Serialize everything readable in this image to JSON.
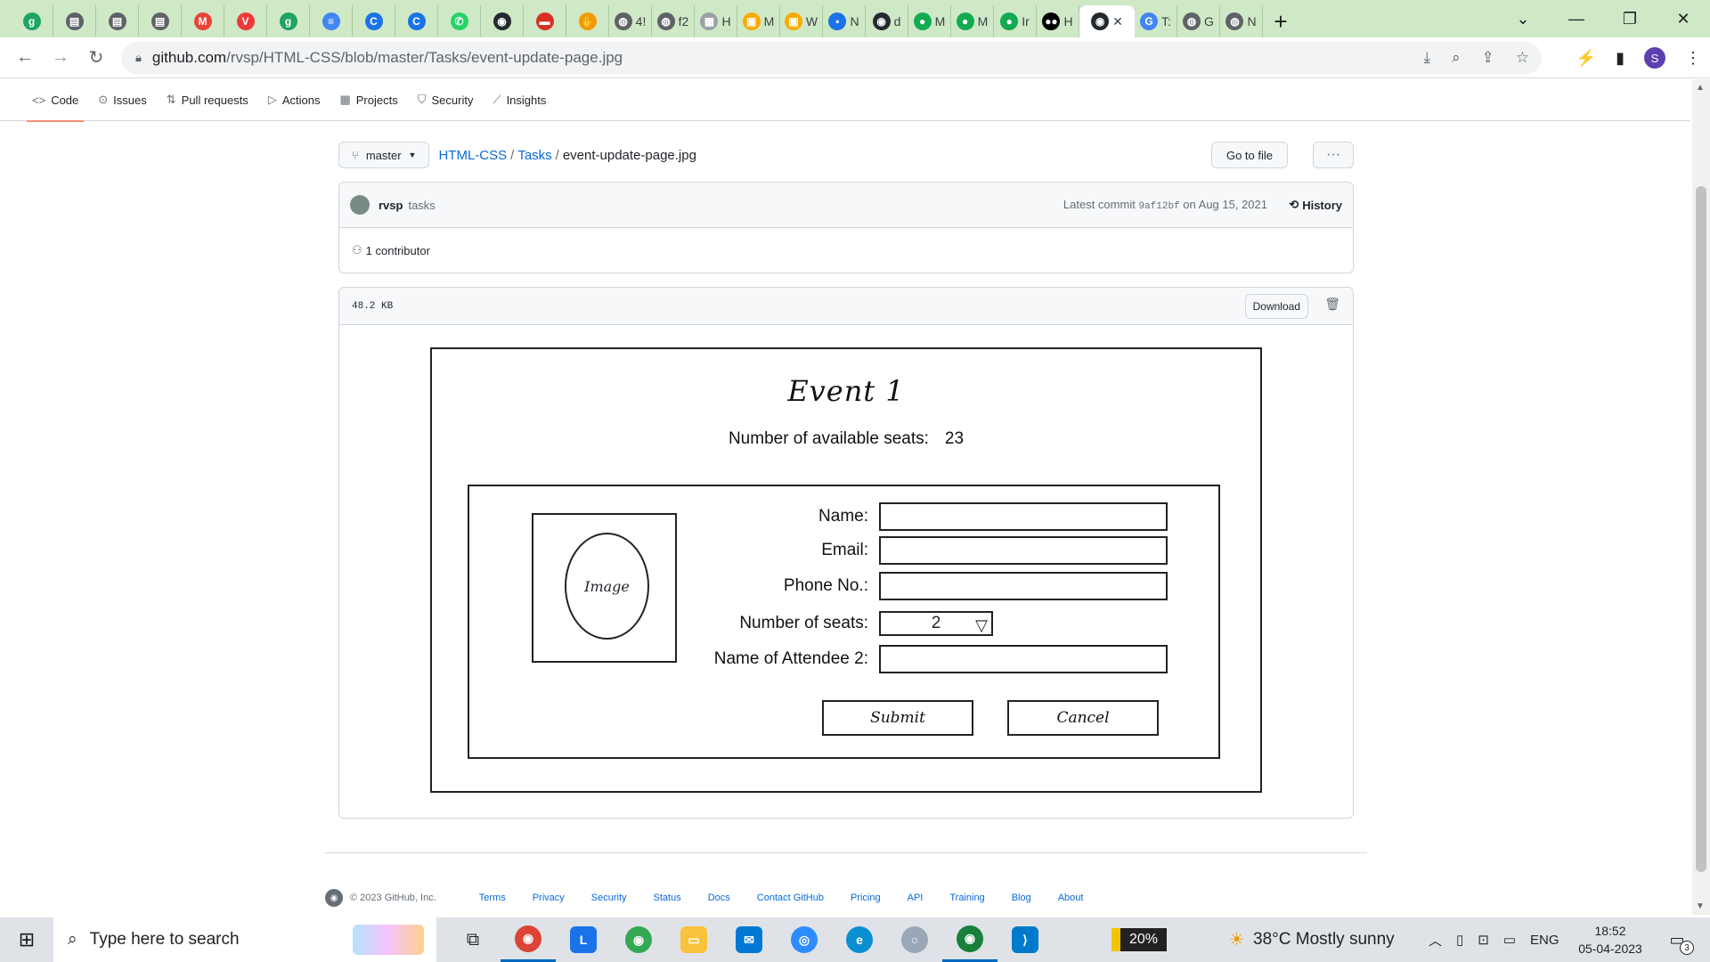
{
  "browser": {
    "tabs": [
      {
        "icon": "green-g-icon",
        "color": "#1fa463",
        "glyph": "g",
        "label": ""
      },
      {
        "icon": "page-icon",
        "color": "#5f6368",
        "glyph": "▤",
        "label": ""
      },
      {
        "icon": "page-icon",
        "color": "#5f6368",
        "glyph": "▤",
        "label": ""
      },
      {
        "icon": "page-icon",
        "color": "#5f6368",
        "glyph": "▤",
        "label": ""
      },
      {
        "icon": "gmail-icon",
        "color": "#ea4335",
        "glyph": "M",
        "label": ""
      },
      {
        "icon": "vivaldi-icon",
        "color": "#ef3939",
        "glyph": "V",
        "label": ""
      },
      {
        "icon": "green-g-icon",
        "color": "#1fa463",
        "glyph": "g",
        "label": ""
      },
      {
        "icon": "docs-icon",
        "color": "#4285f4",
        "glyph": "≡",
        "label": ""
      },
      {
        "icon": "c-icon",
        "color": "#1a73e8",
        "glyph": "C",
        "label": ""
      },
      {
        "icon": "c-icon",
        "color": "#1a73e8",
        "glyph": "C",
        "label": ""
      },
      {
        "icon": "whatsapp-icon",
        "color": "#25d366",
        "glyph": "✆",
        "label": ""
      },
      {
        "icon": "github-icon",
        "color": "#24292f",
        "glyph": "◉",
        "label": ""
      },
      {
        "icon": "red-icon",
        "color": "#d93025",
        "glyph": "▬",
        "label": ""
      },
      {
        "icon": "hand-icon",
        "color": "#f29900",
        "glyph": "✋",
        "label": ""
      },
      {
        "icon": "globe-icon",
        "color": "#5f6368",
        "glyph": "◍",
        "label": "4!"
      },
      {
        "icon": "globe-icon",
        "color": "#5f6368",
        "glyph": "◍",
        "label": "f2"
      },
      {
        "icon": "image-icon",
        "color": "#9aa0a6",
        "glyph": "▦",
        "label": "H"
      },
      {
        "icon": "cube-icon",
        "color": "#f9ab00",
        "glyph": "▣",
        "label": "M"
      },
      {
        "icon": "cube-icon",
        "color": "#f9ab00",
        "glyph": "▣",
        "label": "W"
      },
      {
        "icon": "blue-icon",
        "color": "#1a73e8",
        "glyph": "▪",
        "label": "N"
      },
      {
        "icon": "github-icon",
        "color": "#24292f",
        "glyph": "◉",
        "label": "d"
      },
      {
        "icon": "mongo-icon",
        "color": "#13aa52",
        "glyph": "●",
        "label": "M"
      },
      {
        "icon": "mongo-icon",
        "color": "#13aa52",
        "glyph": "●",
        "label": "M"
      },
      {
        "icon": "mongo-icon",
        "color": "#13aa52",
        "glyph": "●",
        "label": "Ir"
      },
      {
        "icon": "medium-icon",
        "color": "#000000",
        "glyph": "●●",
        "label": "H"
      }
    ],
    "active_tab": {
      "icon": "github-icon",
      "close": "✕"
    },
    "tabs_after": [
      {
        "icon": "google-icon",
        "color": "#4285f4",
        "glyph": "G",
        "label": "T:"
      },
      {
        "icon": "globe-icon",
        "color": "#5f6368",
        "glyph": "◍",
        "label": "G"
      },
      {
        "icon": "chrome-icon",
        "color": "#5f6368",
        "glyph": "◍",
        "label": "N"
      }
    ],
    "new_tab": "+",
    "url_host": "github.com",
    "url_path": "/rvsp/HTML-CSS/blob/master/Tasks/event-update-page.jpg",
    "profile_initial": "S"
  },
  "repo_nav": {
    "items": [
      {
        "icon": "<>",
        "label": "Code"
      },
      {
        "icon": "⊙",
        "label": "Issues"
      },
      {
        "icon": "⇅",
        "label": "Pull requests"
      },
      {
        "icon": "▷",
        "label": "Actions"
      },
      {
        "icon": "▦",
        "label": "Projects"
      },
      {
        "icon": "⛉",
        "label": "Security"
      },
      {
        "icon": "⟋",
        "label": "Insights"
      }
    ]
  },
  "file_header": {
    "branch": "master",
    "repo": "HTML-CSS",
    "folder": "Tasks",
    "file": "event-update-page.jpg",
    "goto_label": "Go to file",
    "more_label": "···"
  },
  "commit": {
    "author": "rvsp",
    "message": "tasks",
    "latest_label": "Latest commit",
    "sha": "9af12bf",
    "date_text": "on Aug 15, 2021",
    "history_label": "History",
    "contributors": "1 contributor"
  },
  "blob": {
    "size": "48.2 KB",
    "download_label": "Download"
  },
  "wireframe": {
    "title": "Event 1",
    "seats_label": "Number of available seats:",
    "seats_value": "23",
    "image_label": "Image",
    "fields": [
      {
        "label": "Name:"
      },
      {
        "label": "Email:"
      },
      {
        "label": "Phone No.:"
      },
      {
        "label": "Number of seats:",
        "value": "2"
      },
      {
        "label": "Name of Attendee 2:"
      }
    ],
    "submit_label": "Submit",
    "cancel_label": "Cancel"
  },
  "footer": {
    "copyright": "© 2023 GitHub, Inc.",
    "links": [
      "Terms",
      "Privacy",
      "Security",
      "Status",
      "Docs",
      "Contact GitHub",
      "Pricing",
      "API",
      "Training",
      "Blog",
      "About"
    ]
  },
  "taskbar": {
    "search_placeholder": "Type here to search",
    "battery": "20%",
    "weather": "38°C  Mostly sunny",
    "language": "ENG",
    "time": "18:52",
    "date": "05-04-2023",
    "notifications": "3"
  }
}
